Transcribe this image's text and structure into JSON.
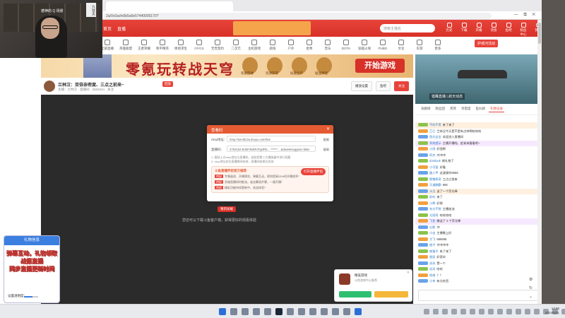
{
  "webcam": {
    "sign_text": "德神的 Q 场景",
    "tag_text": "九在天"
  },
  "browser": {
    "tab_title": "",
    "url": "2a/0c0acfe6b5a6e57440000170?",
    "window_icons": "— ⧉ ✕"
  },
  "site": {
    "logo": "首页",
    "logo2": "直播",
    "banner": "",
    "search_placeholder": "搜索主播名",
    "nav": [
      "历史",
      "下载",
      "开播",
      "消息",
      "鱼吧",
      "粉丝中心",
      "我的"
    ],
    "categories": [
      "全部直播",
      "英雄联盟",
      "王者荣耀",
      "和平精英",
      "绝地求生",
      "CF/CS",
      "无畏契约",
      "二次元",
      "主机游戏",
      "颜值",
      "户外",
      "星秀",
      "音乐",
      "DOTA",
      "穿越火线",
      "PUBG",
      "文化",
      "车游",
      "更多"
    ],
    "hot_label": "护城河活动"
  },
  "ad": {
    "title": "零氪玩转战天穹",
    "cta": "开始游戏",
    "emblem_labels": [
      "装备回收",
      "资源获取",
      "技能全开",
      "极品神宠"
    ]
  },
  "side_video": {
    "caption": "猎鹰直播 | 航天动态"
  },
  "streamer": {
    "name": "兰林汉：双倍亲密度、三点之前来~",
    "sub": "主播：兰林汉 · 直播间 · 2563344 · 关注",
    "tag": "回放",
    "buttons": [
      "播放设置",
      "鱼吧",
      "关注"
    ]
  },
  "player": {
    "error_text": "您还可以下载斗鱼客户端，获得更好的观看体验",
    "retry": "重新加载"
  },
  "modal": {
    "title": "查看码",
    "close": "✕",
    "rtmp_label": "rtmp地址：",
    "rtmp_value": "rtmp://sendtc3a.douyu.com/live",
    "key_label": "直播码：",
    "key_value": "4753152-BJMY9d0Fd7gdFkt... ****** ...&dweeksuggest=false",
    "copy": "复制",
    "notes": [
      "1. 复制上方rtmp地址与直播码，粘贴到第三方播放器中进行观看",
      "2. rtmp地址仅在直播期间有效，直播间结束后失效"
    ],
    "promo_title": "斗鱼直播伴侣官方推荐",
    "promo_button": "打开直播伴侣",
    "promo_lines": [
      {
        "tag": "特权",
        "text": "专属画质、开播预览、弹幕互动，帮你提高25%的开播效率！"
      },
      {
        "tag": "特权",
        "text": "多路直播同时推流，省去繁琐步骤，一键开播！"
      },
      {
        "tag": "特权",
        "text": "精彩功能持续更新中，欢迎体验！"
      }
    ]
  },
  "chat": {
    "tabs": [
      "贡献榜",
      "粉丝团",
      "贵宾",
      "亲密度",
      "鱼丸榜",
      "礼物记录"
    ],
    "messages": [
      {
        "user": "不吹不黑",
        "text": "来了来了",
        "style": "hl2"
      },
      {
        "user": "乙巳",
        "text": "兰林汉今天是不是有点帅啊哈哈哈",
        "style": ""
      },
      {
        "user": "鱼丸宝宝",
        "text": "欢迎进入直播间",
        "style": ""
      },
      {
        "user": "系统提示",
        "text": "主播开播啦，赶紧来看看吧~",
        "style": "hl"
      },
      {
        "user": "小雨",
        "text": "好强啊",
        "style": ""
      },
      {
        "user": "阿杰",
        "text": "冲冲冲",
        "style": ""
      },
      {
        "user": "dontlook",
        "text": "刷礼物了",
        "style": ""
      },
      {
        "user": "小可爱",
        "text": "好看",
        "style": ""
      },
      {
        "user": "路人甲",
        "text": "这波操作6666",
        "style": ""
      },
      {
        "user": "野猪佩奇",
        "text": "三点之前来",
        "style": ""
      },
      {
        "user": "天道酬勤",
        "text": "666",
        "style": ""
      },
      {
        "user": "水月",
        "text": "送了一个荧光棒",
        "style": "hl2"
      },
      {
        "user": "彩虹",
        "text": "来了",
        "style": ""
      },
      {
        "user": "小熊",
        "text": "好耶",
        "style": ""
      },
      {
        "user": "东方不败",
        "text": "主播加油",
        "style": ""
      },
      {
        "user": "太阳雨",
        "text": "哈哈哈哈",
        "style": ""
      },
      {
        "user": "飞鱼",
        "text": "赠送了 2 个荧光棒",
        "style": "hl"
      },
      {
        "user": "幻影",
        "text": "冲",
        "style": ""
      },
      {
        "user": "小白",
        "text": "主播晚上好",
        "style": ""
      },
      {
        "user": "大飞",
        "text": "666666",
        "style": ""
      },
      {
        "user": "橙子",
        "text": "冲冲冲冲",
        "style": ""
      },
      {
        "user": "夜猫子",
        "text": "来了来了",
        "style": ""
      },
      {
        "user": "星辰",
        "text": "好家伙",
        "style": ""
      },
      {
        "user": "凉风",
        "text": "赞一个",
        "style": ""
      },
      {
        "user": "北风",
        "text": "哈哈",
        "style": ""
      },
      {
        "user": "柯南",
        "text": "？？",
        "style": ""
      },
      {
        "user": "小李",
        "text": "有点东西",
        "style": ""
      },
      {
        "user": "老王",
        "text": "加油",
        "style": ""
      },
      {
        "user": "阿呆",
        "text": "666",
        "style": ""
      },
      {
        "user": "风铃",
        "text": "来了",
        "style": ""
      }
    ]
  },
  "adpop": {
    "title": "精美游戏",
    "desc": "斗鱼游戏中心推荐",
    "close": "✕"
  },
  "gift": {
    "header": "礼物信息",
    "lines": [
      "弹幕互动，礼物领取",
      "战报直播",
      "同步直播更新时间"
    ],
    "slider_label": "设置透明度：",
    "opacity": 0.6
  },
  "sideicons": [
    "⚙",
    "↻",
    "⌄"
  ],
  "taskbar": {
    "clock_time": "14:56",
    "clock_date": "2024/5/21"
  }
}
